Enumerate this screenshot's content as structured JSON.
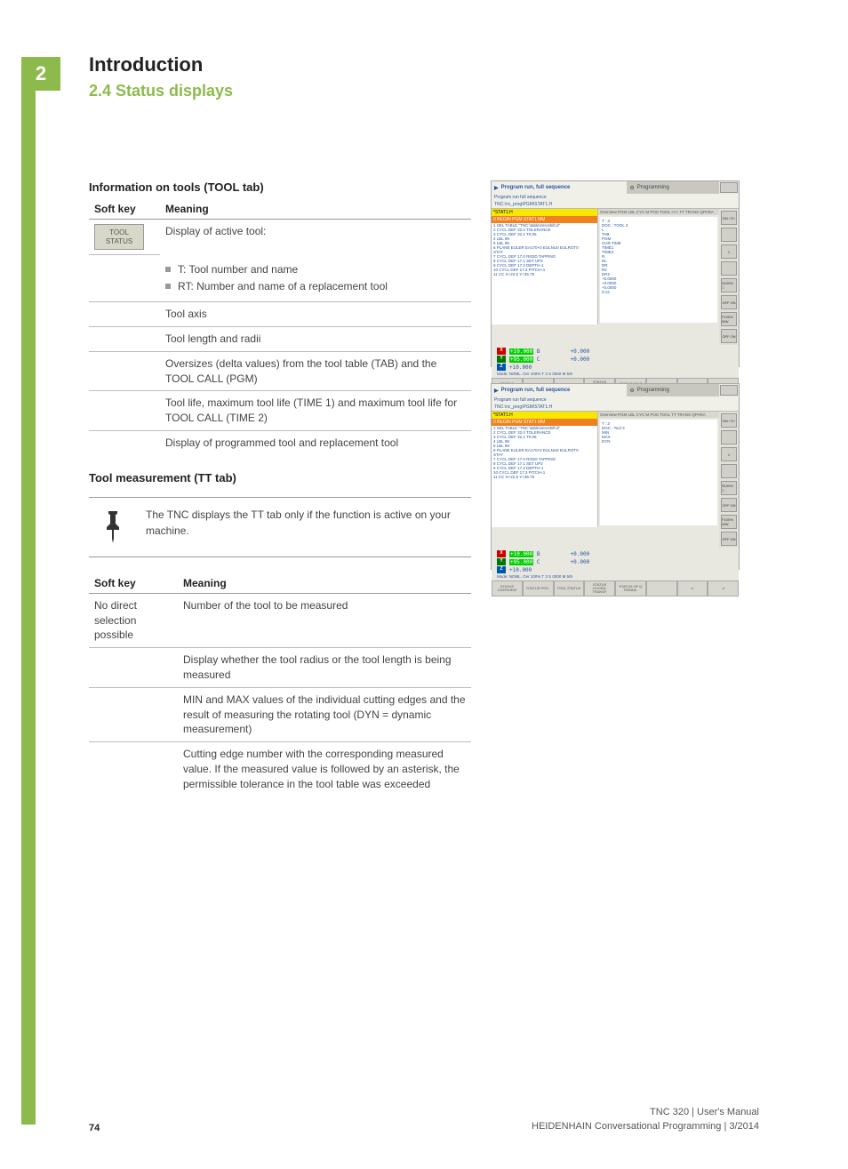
{
  "chapter_number": "2",
  "chapter_title": "Introduction",
  "section_label": "2.4   Status displays",
  "tool_tab": {
    "heading": "Information on tools (TOOL tab)",
    "col_softkey": "Soft key",
    "col_meaning": "Meaning",
    "softkey_label": "TOOL\nSTATUS",
    "row1_intro": "Display of active tool:",
    "row1_b1": "T: Tool number and name",
    "row1_b2": "RT: Number and name of a replacement tool",
    "row2": "Tool axis",
    "row3": "Tool length and radii",
    "row4": "Oversizes (delta values) from the tool table (TAB) and the TOOL CALL (PGM)",
    "row5": "Tool life, maximum tool life (TIME 1) and maximum tool life for TOOL CALL (TIME 2)",
    "row6": "Display of programmed tool and replacement tool"
  },
  "tt_tab": {
    "heading": "Tool measurement (TT tab)",
    "note": "The TNC displays the TT tab only if the function is active on your machine.",
    "col_softkey": "Soft key",
    "col_meaning": "Meaning",
    "softkey_text": "No direct selection possible",
    "row1": "Number of the tool to be measured",
    "row2": "Display whether the tool radius or the tool length is being measured",
    "row3": "MIN and MAX values of the individual cutting edges and the result of measuring the rotating tool (DYN = dynamic measurement)",
    "row4": "Cutting edge number with the corresponding measured value. If the measured value is followed by an asterisk, the permissible tolerance in the tool table was exceeded"
  },
  "screenshot1": {
    "title_left": "Program run, full sequence",
    "title_right": "Programming",
    "subtitle": "Program run full sequence",
    "path": "TNC:\\nc_prog\\PGM\\STAT1.H",
    "yellow1": "*STAT1.H",
    "orange1": "0  BEGIN PGM STAT1 MM",
    "prog_lines": [
      "1  SEL TABLE \"TNC:\\table\\zeroshift.d\"",
      "2  CYCL DEF 32.0 TOLERANCE",
      "3  CYCL DEF 32.1 T0.05",
      "4  LBL 99",
      "5  LBL 98",
      "6  PLANE EULER EA170+0 EULNU0 EULROT0",
      "   STAY",
      "7  CYCL DEF 17.0 RIGID TAPPING",
      "8  CYCL DEF 17.1 SET UP2",
      "9  CYCL DEF 17.2 DEPTH-1",
      "10 CYCL DEF 17.3 PITCH+1",
      "11 CC  X+22.5  Y+35.75"
    ],
    "tabs": "Overview PGM LBL CYC M POS TOOL >>> TT TRANS QPARA",
    "info_lines": [
      "T : 3",
      "DOC : TOOL 3",
      "L",
      "TAB",
      "PGM",
      "CUR.TIME",
      "TIME1",
      "TIME2",
      "R",
      "DL",
      "DR",
      "R2",
      "DR2",
      "+0.0000",
      "+0.0000",
      "+0.0000",
      "0:12"
    ],
    "axes": {
      "x": "+10.000",
      "x2": "+0.000",
      "y": "+95.000",
      "y2": "+0.000",
      "z": "+10.000"
    },
    "status_line": "Mode: NOML.    Ovr 100%   T 3   S 0000   M 5/9",
    "bottom_buttons": [
      "STATUS OVERVIEW",
      "STATUS POS.",
      "TOOL STATUS",
      "STATUS COORD. TRANSF.",
      "STATUS OF Q PARAM.",
      "",
      "",
      ""
    ],
    "side_labels": [
      "DN / S+",
      "",
      "1",
      "",
      "S100% □",
      "OFF  ON",
      "F100% WW",
      "OFF  ON"
    ]
  },
  "screenshot2": {
    "title_left": "Program run, full sequence",
    "title_right": "Programming",
    "subtitle": "Program run full sequence",
    "path": "TNC:\\nc_prog\\PGM\\STAT1.H",
    "yellow1": "*STAT1.H",
    "orange1": "0  BEGIN PGM STAT1 MM",
    "prog_lines": [
      "1  SEL TABLE \"TNC:\\table\\zeroshift.d\"",
      "2  CYCL DEF 32.0 TOLERANCE",
      "3  CYCL DEF 32.1 T0.05",
      "4  LBL 99",
      "5  LBL 98",
      "6  PLANE EULER EA170+0 EULNU0 EULROT0",
      "   STAY",
      "7  CYCL DEF 17.0 RIGID TAPPING",
      "8  CYCL DEF 17.1 SET UP2",
      "9  CYCL DEF 17.2 DEPTH-1",
      "10 CYCL DEF 17.3 PITCH+1",
      "11 CC  X+22.5  Y+35.75"
    ],
    "tabs": "Overview PGM LBL CYC M POS TOOL   TT TRANS QPARA",
    "info_lines": [
      "T : 3",
      "DOC : Tool 3",
      "MIN",
      "MAX",
      "DYN"
    ],
    "axes": {
      "x": "+10.000",
      "x2": "+0.000",
      "y": "+95.000",
      "y2": "+0.000",
      "z": "+10.000"
    },
    "status_line": "Mode: NOML.    Ovr 100%   T 3   S 0000   M 5/9",
    "bottom_buttons": [
      "STATUS OVERVIEW",
      "STATUS POS.",
      "TOOL STATUS",
      "STATUS COORD. TRANSF.",
      "STATUS OF Q PARAM.",
      "",
      "⇐",
      "⇒"
    ],
    "side_labels": [
      "DN / S+",
      "",
      "1",
      "",
      "S100% □",
      "OFF  ON",
      "F100% WW",
      "OFF  ON"
    ]
  },
  "footer": {
    "page": "74",
    "line1": "TNC 320 | User's Manual",
    "line2": "HEIDENHAIN Conversational Programming | 3/2014"
  }
}
